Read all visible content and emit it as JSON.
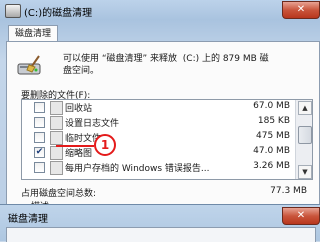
{
  "window": {
    "title": "(C:)的磁盘清理",
    "close_glyph": "✕"
  },
  "tabs": [
    {
      "label": "磁盘清理"
    }
  ],
  "info": {
    "text": "可以使用 “磁盘清理” 来释放  (C:) 上的 879 MB 磁\n盘空间。"
  },
  "list": {
    "label": "要删除的文件(F):",
    "items": [
      {
        "name": "回收站",
        "size": "67.0 MB",
        "checked": false
      },
      {
        "name": "设置日志文件",
        "size": "185 KB",
        "checked": false
      },
      {
        "name": "临时文件",
        "size": "475 MB",
        "checked": false
      },
      {
        "name": "缩略图",
        "size": "47.0 MB",
        "checked": true
      },
      {
        "name": "每用户存档的 Windows 错误报告...",
        "size": "3.26 MB",
        "checked": false
      }
    ],
    "scroll_up": "▲",
    "scroll_down": "▼"
  },
  "annotation": {
    "number": "1",
    "color": "#e41b1b"
  },
  "total": {
    "label": "占用磁盘空间总数:",
    "value": "77.3 MB"
  },
  "description": {
    "label": "描述"
  },
  "dialog": {
    "title": "磁盘清理",
    "close_glyph": "✕"
  },
  "icons": {
    "app": "disk-cleanup-icon",
    "drive": "drive-with-broom-icon",
    "files": [
      "recycle-bin-icon",
      "log-file-icon",
      "temp-file-icon",
      "thumbnail-icon",
      "error-report-icon"
    ]
  }
}
